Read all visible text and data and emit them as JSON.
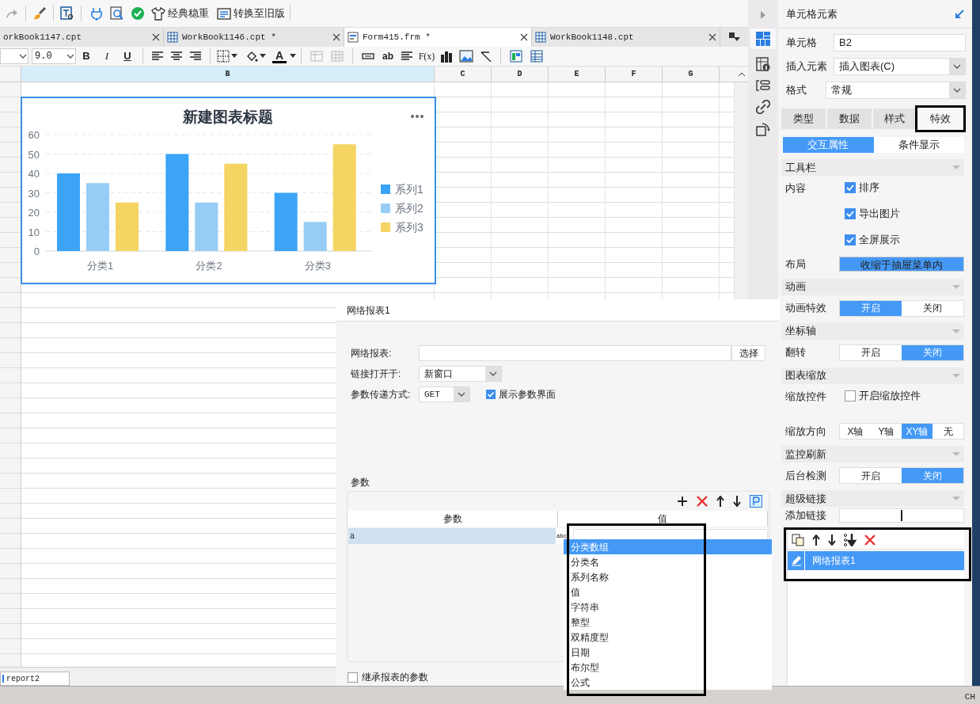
{
  "toolbar": {
    "theme_button": "经典稳重",
    "legacy_button": "转换至旧版"
  },
  "tabs": [
    {
      "label": "orkBook1147.cpt",
      "selected": false
    },
    {
      "label": "WorkBook1146.cpt *",
      "kind": "report",
      "selected": false
    },
    {
      "label": "Form415.frm *",
      "kind": "form",
      "selected": true
    },
    {
      "label": "WorkBook1148.cpt",
      "kind": "report",
      "selected": false
    }
  ],
  "format_bar": {
    "font_size": "9.0",
    "bold": "B",
    "italic": "I",
    "underline": "U",
    "font_color": "A",
    "text_tool": "ab",
    "formula": "F(x)"
  },
  "columns": [
    {
      "label": "B",
      "selected": true
    },
    {
      "label": "C",
      "selected": false
    },
    {
      "label": "D",
      "selected": false
    },
    {
      "label": "E",
      "selected": false
    },
    {
      "label": "F",
      "selected": false
    },
    {
      "label": "G",
      "selected": false
    }
  ],
  "chart": {
    "chart_data": {
      "type": "bar",
      "title": "新建图表标题",
      "categories": [
        "分类1",
        "分类2",
        "分类3"
      ],
      "series": [
        {
          "name": "系列1",
          "color": "#3ba4f7",
          "values": [
            40,
            50,
            30
          ]
        },
        {
          "name": "系列2",
          "color": "#96cdf6",
          "values": [
            35,
            25,
            15
          ]
        },
        {
          "name": "系列3",
          "color": "#f4d462",
          "values": [
            25,
            45,
            55
          ]
        }
      ],
      "ylim": [
        0,
        60
      ],
      "yticks": [
        0,
        10,
        20,
        30,
        40,
        50,
        60
      ],
      "grid": true,
      "legend": true
    }
  },
  "sheet_tab": "report2",
  "dialog": {
    "title": "网络报表1",
    "report_label": "网络报表:",
    "choose_button": "选择",
    "open_label": "链接打开于:",
    "open_value": "新窗口",
    "method_label": "参数传递方式:",
    "method_value": "GET",
    "show_params": {
      "label": "展示参数界面",
      "checked": true
    },
    "params_group": "参数",
    "table": {
      "columns": [
        "参数",
        "值"
      ],
      "rows": [
        {
          "param": "a",
          "type_icon": "abc",
          "selected": true
        }
      ]
    },
    "type_menu": {
      "outlined": true,
      "items": [
        {
          "label": "分类数组",
          "selected": true
        },
        {
          "label": "分类名",
          "selected": false
        },
        {
          "label": "系列名称",
          "selected": false
        },
        {
          "label": "值",
          "selected": false
        },
        {
          "label": "字符串",
          "selected": false
        },
        {
          "label": "整型",
          "selected": false
        },
        {
          "label": "双精度型",
          "selected": false
        },
        {
          "label": "日期",
          "selected": false
        },
        {
          "label": "布尔型",
          "selected": false
        },
        {
          "label": "公式",
          "selected": false
        }
      ]
    },
    "inherit": {
      "label": "继承报表的参数",
      "checked": false
    }
  },
  "side_panel": {
    "title": "单元格元素",
    "fields": [
      {
        "label": "单元格",
        "value": "B2",
        "kind": "text"
      },
      {
        "label": "插入元素",
        "value": "插入图表(C)",
        "kind": "select"
      },
      {
        "label": "格式",
        "value": "常规",
        "kind": "select"
      }
    ],
    "tabs": [
      {
        "label": "类型",
        "selected": false,
        "outlined": false
      },
      {
        "label": "数据",
        "selected": false,
        "outlined": false
      },
      {
        "label": "样式",
        "selected": false,
        "outlined": false
      },
      {
        "label": "特效",
        "selected": true,
        "outlined": true
      }
    ],
    "subtabs": [
      {
        "label": "交互属性",
        "selected": true
      },
      {
        "label": "条件显示",
        "selected": false
      }
    ],
    "sections": [
      {
        "title": "工具栏",
        "rows": [
          {
            "kind": "checks",
            "label": "内容",
            "options": [
              {
                "label": "排序",
                "checked": true
              },
              {
                "label": "导出图片",
                "checked": true
              },
              {
                "label": "全屏展示",
                "checked": true
              }
            ]
          },
          {
            "kind": "button",
            "label": "布局",
            "value": "收缩于抽屉菜单内",
            "selected": true
          }
        ]
      },
      {
        "title": "动画",
        "rows": [
          {
            "kind": "segmented",
            "label": "动画特效",
            "options": [
              {
                "label": "开启",
                "selected": true
              },
              {
                "label": "关闭",
                "selected": false
              }
            ]
          }
        ]
      },
      {
        "title": "坐标轴",
        "rows": [
          {
            "kind": "segmented",
            "label": "翻转",
            "options": [
              {
                "label": "开启",
                "selected": false
              },
              {
                "label": "关闭",
                "selected": true
              }
            ]
          }
        ]
      },
      {
        "title": "图表缩放",
        "rows": [
          {
            "kind": "checks",
            "label": "缩放控件",
            "options": [
              {
                "label": "开启缩放控件",
                "checked": false
              }
            ]
          },
          {
            "kind": "segmented",
            "label": "缩放方向",
            "options": [
              {
                "label": "X轴",
                "selected": false
              },
              {
                "label": "Y轴",
                "selected": false
              },
              {
                "label": "XY轴",
                "selected": true
              },
              {
                "label": "无",
                "selected": false
              }
            ]
          }
        ]
      },
      {
        "title": "监控刷新",
        "rows": [
          {
            "kind": "segmented",
            "label": "后台检测",
            "options": [
              {
                "label": "开启",
                "selected": false
              },
              {
                "label": "关闭",
                "selected": true
              }
            ]
          }
        ]
      },
      {
        "title": "超级链接",
        "rows": [
          {
            "kind": "add",
            "label": "添加链接"
          }
        ]
      }
    ],
    "links": {
      "outlined": true,
      "items": [
        {
          "label": "网络报表1",
          "selected": true
        }
      ]
    }
  },
  "status_bar": "CH"
}
